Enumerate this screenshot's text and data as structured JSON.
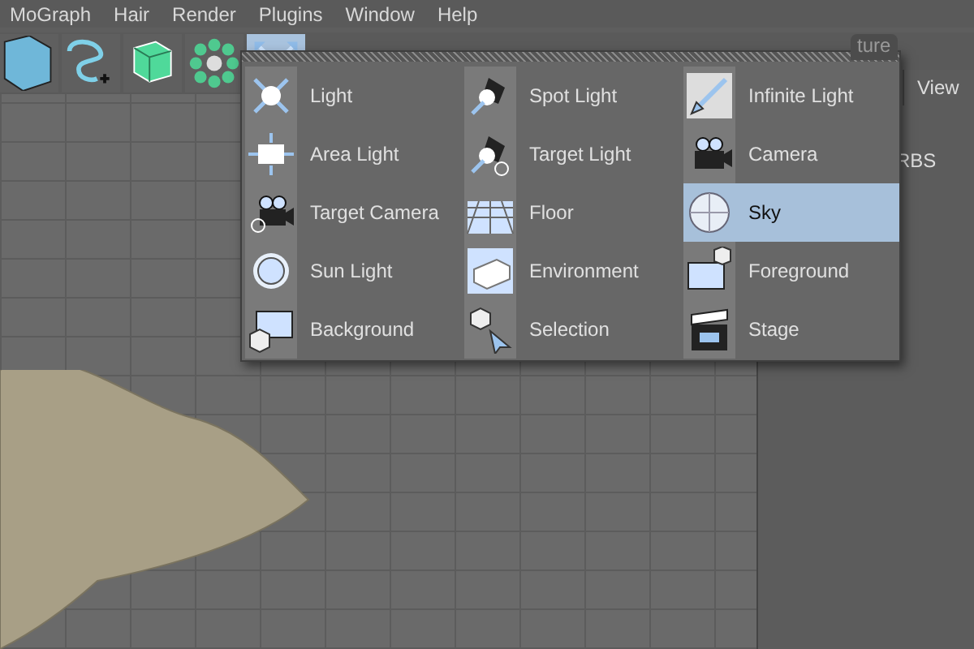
{
  "menu_bar": [
    "MoGraph",
    "Hair",
    "Render",
    "Plugins",
    "Window",
    "Help"
  ],
  "toolbar": [
    {
      "selected": false
    },
    {
      "selected": false
    },
    {
      "selected": false
    },
    {
      "selected": false
    },
    {
      "selected": true
    }
  ],
  "side_panel": {
    "tab": "ture",
    "view_button": "View",
    "row_label": "RBS"
  },
  "popup_columns": [
    [
      {
        "label": "Light",
        "selected": false
      },
      {
        "label": "Area Light",
        "selected": false
      },
      {
        "label": "Target Camera",
        "selected": false
      },
      {
        "label": "Sun Light",
        "selected": false
      },
      {
        "label": "Background",
        "selected": false
      }
    ],
    [
      {
        "label": "Spot Light",
        "selected": false
      },
      {
        "label": "Target Light",
        "selected": false
      },
      {
        "label": "Floor",
        "selected": false
      },
      {
        "label": "Environment",
        "selected": false
      },
      {
        "label": "Selection",
        "selected": false
      }
    ],
    [
      {
        "label": "Infinite Light",
        "selected": false
      },
      {
        "label": "Camera",
        "selected": false
      },
      {
        "label": "Sky",
        "selected": true
      },
      {
        "label": "Foreground",
        "selected": false
      },
      {
        "label": "Stage",
        "selected": false
      }
    ]
  ]
}
